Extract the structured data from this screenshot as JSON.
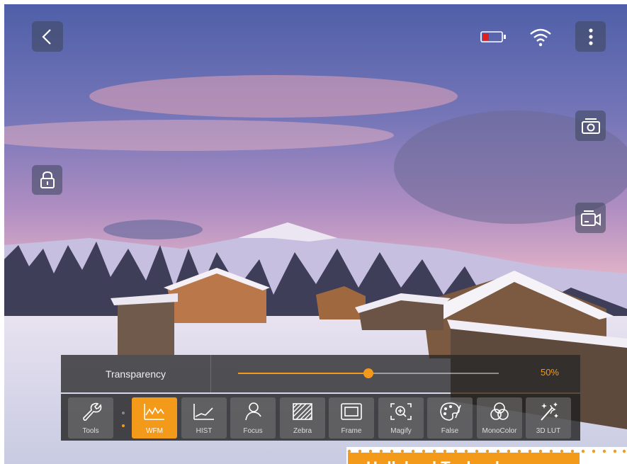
{
  "top_bar": {
    "back_icon": "chevron-left-icon",
    "battery_icon": "battery-low-icon",
    "wifi_icon": "wifi-icon",
    "menu_icon": "more-vertical-icon"
  },
  "side_buttons": {
    "lock_icon": "lock-icon",
    "snapshot_icon": "camera-icon",
    "record_icon": "video-record-icon"
  },
  "transparency": {
    "label": "Transparency",
    "value_text": "50%",
    "value": 0.5
  },
  "toolbar": {
    "tools": [
      {
        "label": "Tools",
        "icon": "wrench-icon",
        "active": false
      },
      {
        "label": "WFM",
        "icon": "waveform-icon",
        "active": true
      },
      {
        "label": "HIST",
        "icon": "histogram-icon",
        "active": false
      },
      {
        "label": "Focus",
        "icon": "focus-person-icon",
        "active": false
      },
      {
        "label": "Zebra",
        "icon": "zebra-stripes-icon",
        "active": false
      },
      {
        "label": "Frame",
        "icon": "frame-icon",
        "active": false
      },
      {
        "label": "Magify",
        "icon": "magnifier-icon",
        "active": false
      },
      {
        "label": "False",
        "icon": "palette-icon",
        "active": false
      },
      {
        "label": "MonoColor",
        "icon": "color-circles-icon",
        "active": false
      },
      {
        "label": "3D LUT",
        "icon": "magic-wand-icon",
        "active": false
      }
    ]
  },
  "brand_banner": {
    "text": "Hollyland Technology"
  },
  "colors": {
    "accent": "#f39a1a"
  }
}
